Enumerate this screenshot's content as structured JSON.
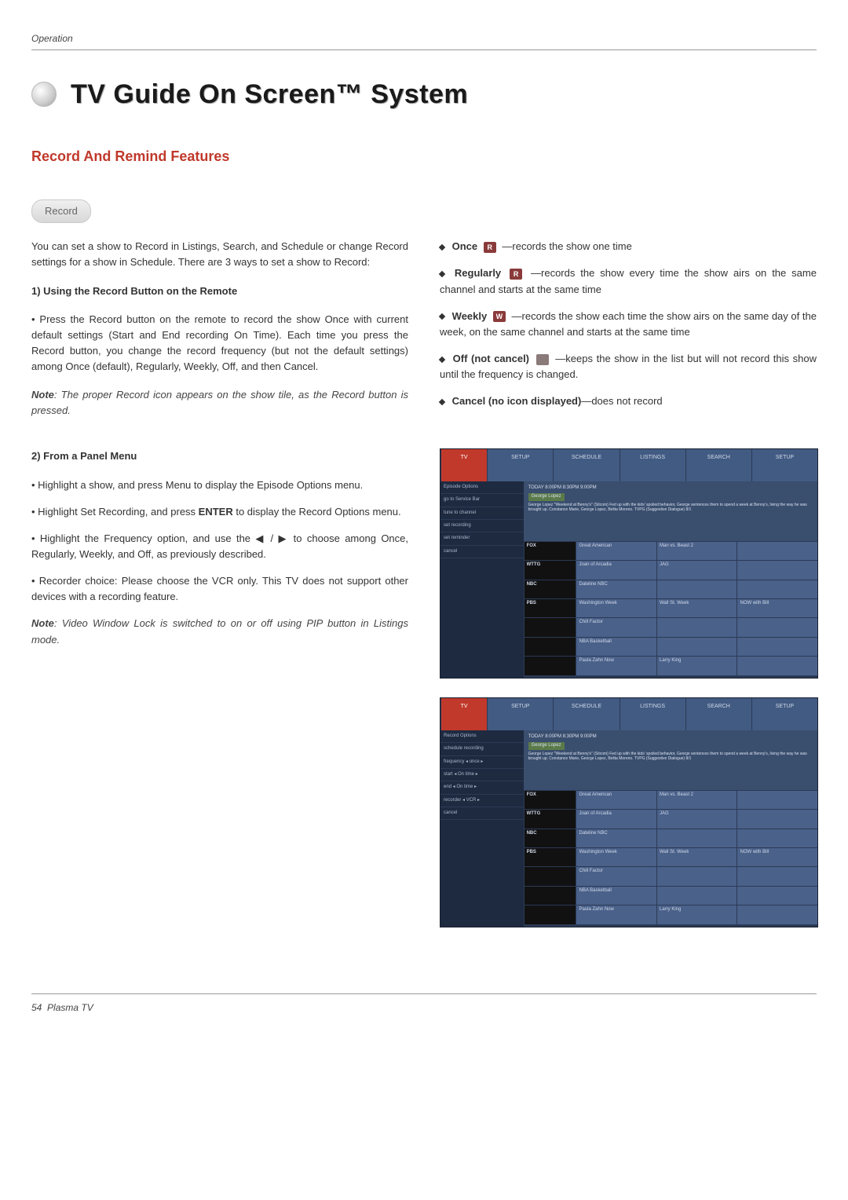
{
  "header": {
    "section": "Operation"
  },
  "title": "TV Guide On Screen™ System",
  "subheading": "Record And Remind Features",
  "pill_label": "Record",
  "left": {
    "intro": "You can set a show to Record in Listings, Search, and Schedule or change Record settings for a show in Schedule. There are 3 ways to set a show to Record:",
    "h1": "1) Using the Record Button on the Remote",
    "p1": "• Press the Record button on the remote to record the show Once with current default settings (Start and End recording On Time). Each time you press the Record button, you change the record frequency (but not the default settings) among Once (default), Regularly, Weekly, Off, and then Cancel.",
    "note1_prefix": "Note",
    "note1_rest": ": The proper Record icon appears on the show tile, as the Record button is pressed.",
    "h2": "2) From a Panel Menu",
    "b1": "• Highlight a show, and press Menu to display the Episode Options menu.",
    "b2_a": "• Highlight Set Recording, and press ",
    "b2_enter": "ENTER",
    "b2_b": " to display the Record Options menu.",
    "b3": "• Highlight the Frequency option, and use the ◀ / ▶  to choose among Once, Regularly, Weekly, and Off, as previously described.",
    "b4": "• Recorder choice: Please choose the VCR only. This TV does not support other devices with a recording feature.",
    "note2_prefix": "Note",
    "note2_rest": ": Video Window Lock is switched  to on or off using PIP button in Listings mode."
  },
  "right": {
    "once_label": "Once",
    "once_rest": " —records the show one time",
    "reg_label": "Regularly",
    "reg_rest": " —records the show every time the show airs on the same channel and starts at the same  time",
    "weekly_label": "Weekly",
    "weekly_rest": " —records the show each time the show airs on the same day of the week, on the same channel and starts at the same time",
    "off_label": "Off (not cancel)",
    "off_rest": " —keeps the show in the list but will not record this show until the frequency is changed.",
    "cancel_label": "Cancel (no icon displayed)",
    "cancel_rest": "—does not record"
  },
  "icons": {
    "r": "R",
    "w": "W"
  },
  "ss": {
    "tabs": [
      "TV",
      "SETUP",
      "SCHEDULE",
      "LISTINGS",
      "SEARCH",
      "SETUP"
    ],
    "left1": [
      "Episode Options",
      "go to Service Bar",
      "tune to channel",
      "set recording",
      "set reminder",
      "cancel"
    ],
    "left2": [
      "Record Options",
      "schedule recording",
      "frequency ◂ once ▸",
      "start ◂ On time ▸",
      "end ◂ On time ▸",
      "recorder ◂ VCR ▸",
      "cancel"
    ],
    "desc_top": "TODAY      8:00PM                 8:30PM              9:00PM",
    "desc_row": "George Lopez",
    "desc_body": "George Lopez \"Weekend at Benny's\" (Sitcom) Fed up with the kids' spoiled behavior, George sentences them to spend a week at Benny's, living the way he was brought up. Constance Marie, George Lopez, Belita Moreno. TVPG (Suggestive Dialogue) 8/1",
    "rows": [
      [
        "FOX",
        "Great American",
        "Man vs. Beast 2"
      ],
      [
        "WTTG",
        "Joan of Arcadia",
        "JAG"
      ],
      [
        "NBC",
        "Dateline NBC",
        ""
      ],
      [
        "PBS",
        "Washington Week",
        "Wall St. Week",
        "NOW with Bill"
      ],
      [
        "",
        "Chill Factor",
        ""
      ],
      [
        "",
        "NBA Basketball",
        ""
      ],
      [
        "",
        "Paula Zahn Now",
        "Larry King"
      ]
    ]
  },
  "footer": {
    "page": "54",
    "label": "Plasma TV"
  }
}
